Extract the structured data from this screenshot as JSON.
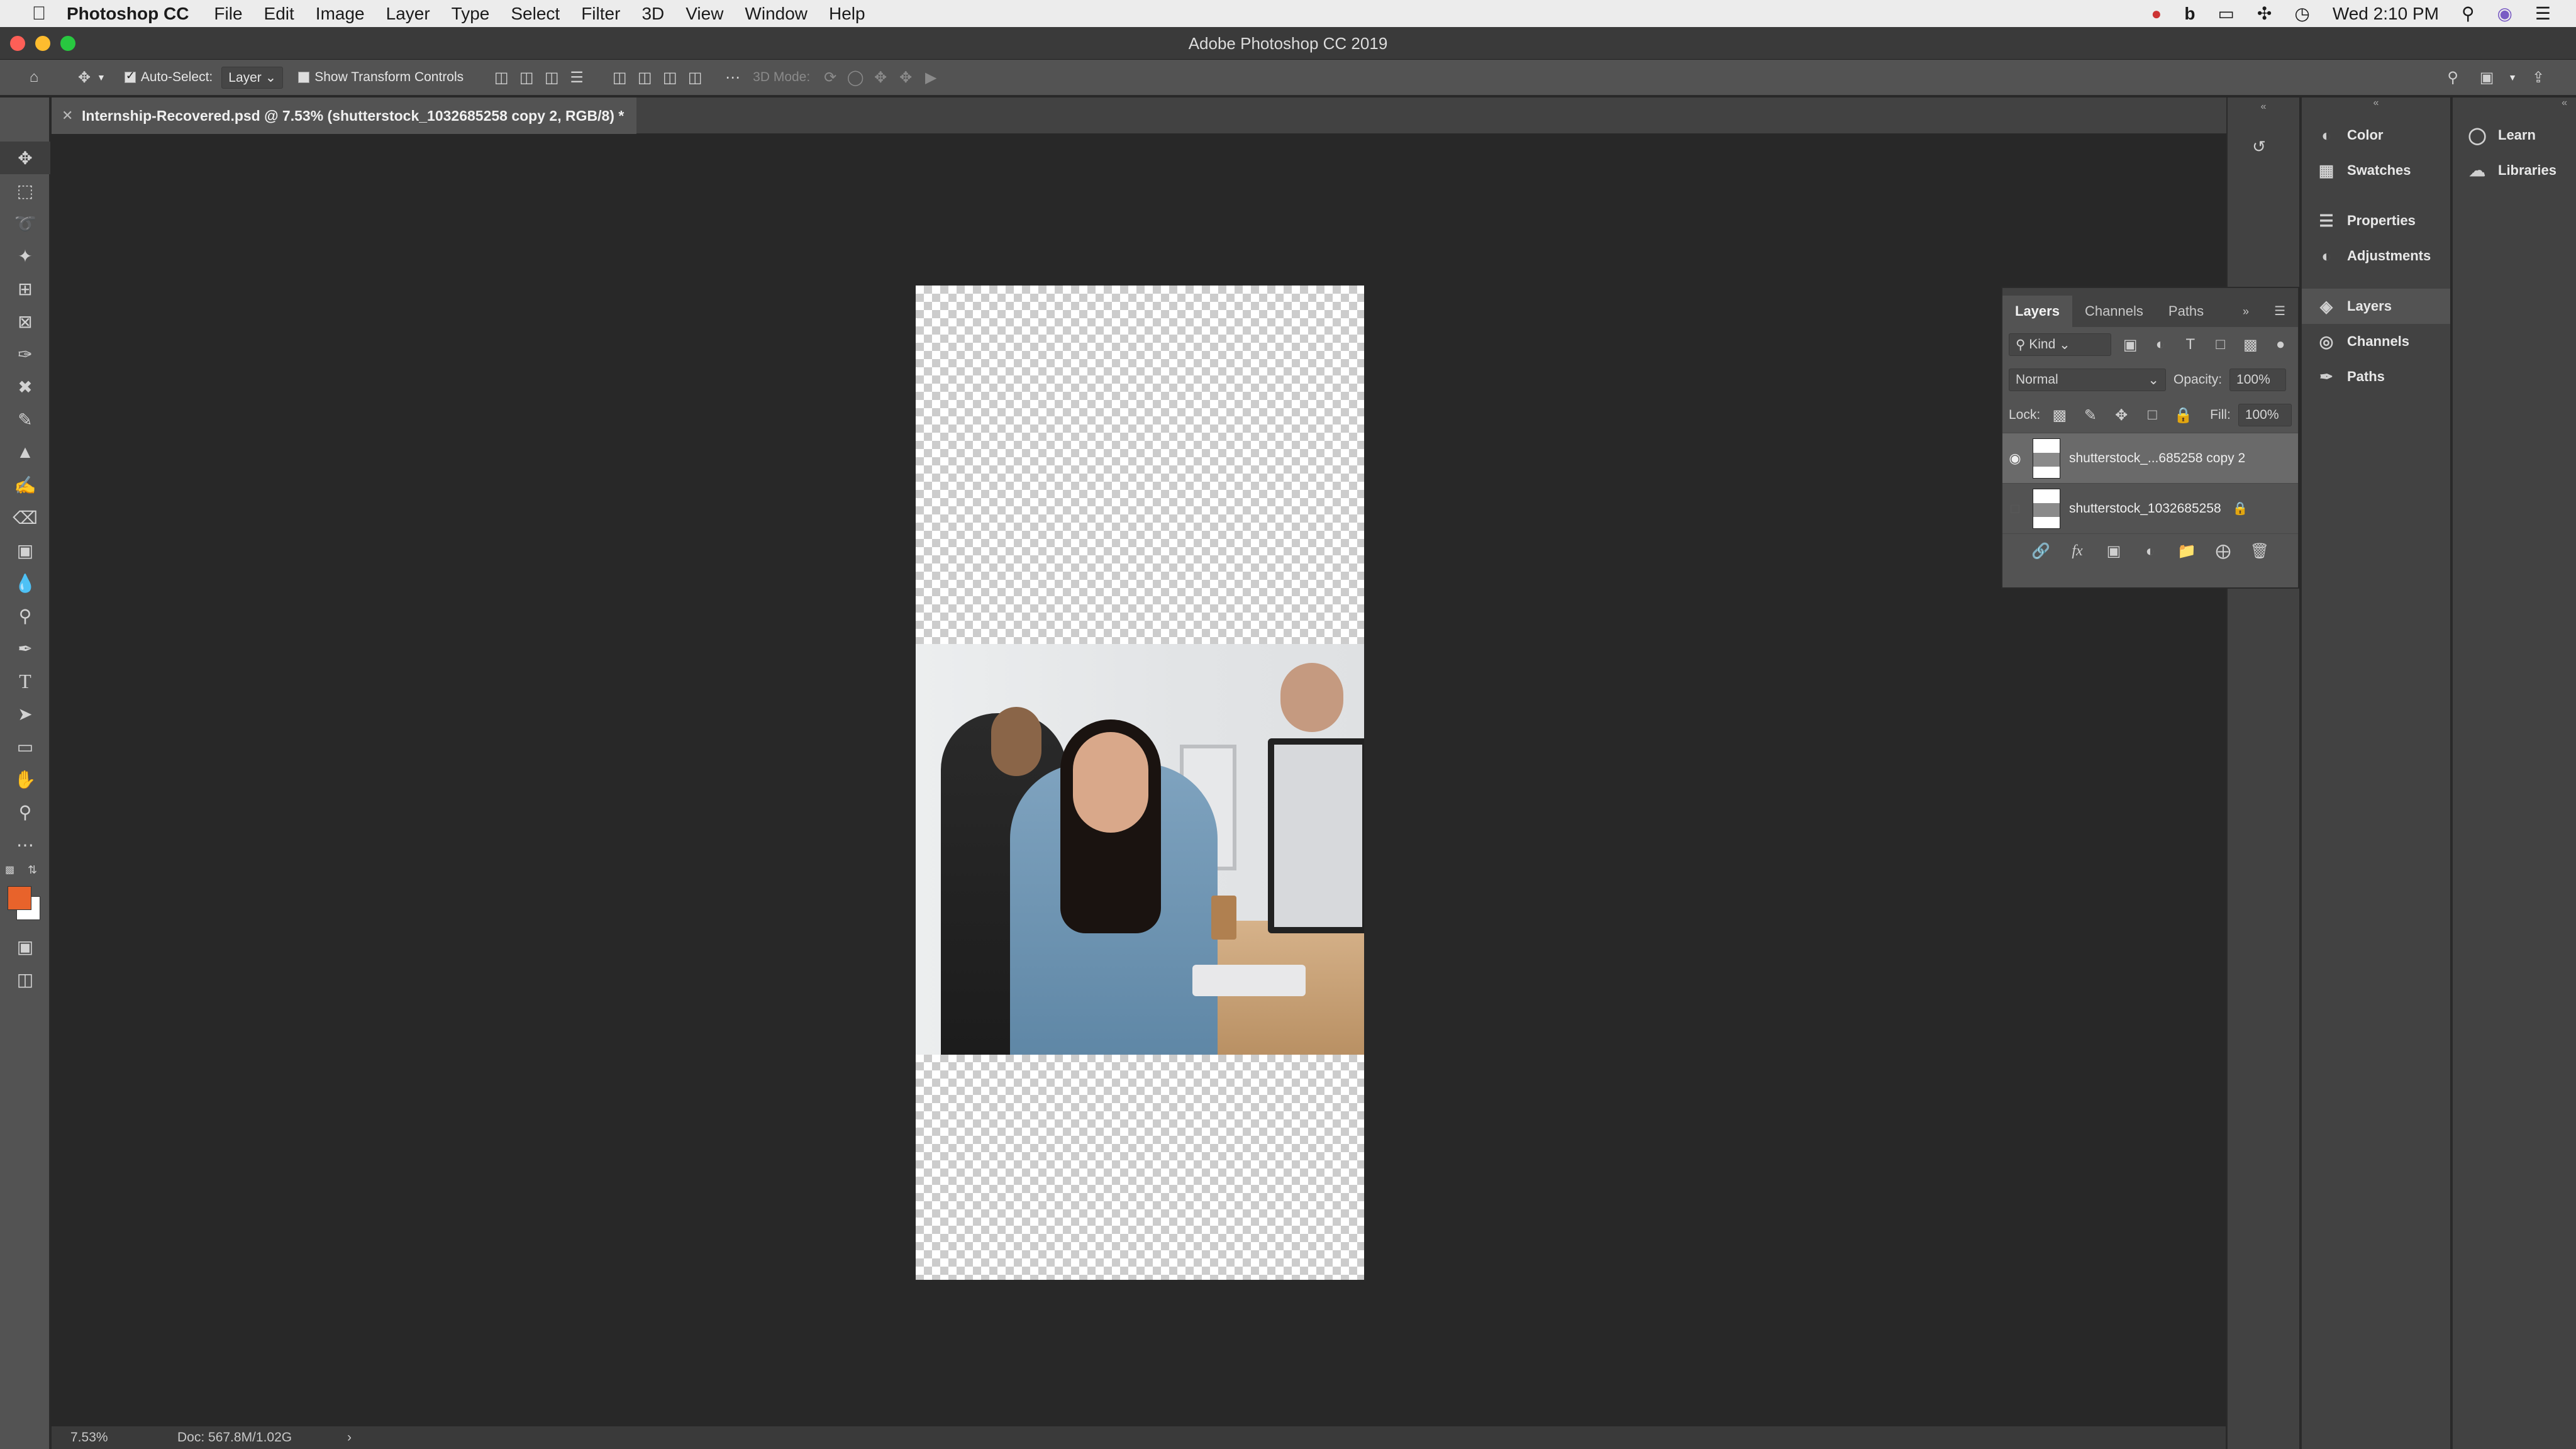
{
  "menubar": {
    "app_name": "Photoshop CC",
    "menus": [
      "File",
      "Edit",
      "Image",
      "Layer",
      "Type",
      "Select",
      "Filter",
      "3D",
      "View",
      "Window",
      "Help"
    ],
    "clock": "Wed 2:10 PM"
  },
  "window": {
    "title": "Adobe Photoshop CC 2019"
  },
  "options": {
    "auto_select_label": "Auto-Select:",
    "auto_select_target": "Layer",
    "transform_label": "Show Transform Controls",
    "mode_label": "3D Mode:"
  },
  "document": {
    "tab_title": "Internship-Recovered.psd @ 7.53% (shutterstock_1032685258 copy 2, RGB/8) *"
  },
  "status": {
    "zoom": "7.53%",
    "doc": "Doc: 567.8M/1.02G",
    "arrow": "›"
  },
  "colors": {
    "foreground": "#e8632b",
    "background": "#ffffff"
  },
  "panels_col": {
    "items": [
      "Color",
      "Swatches",
      "Properties",
      "Adjustments",
      "Layers",
      "Channels",
      "Paths"
    ]
  },
  "learn_col": {
    "items": [
      "Learn",
      "Libraries"
    ]
  },
  "layers_panel": {
    "tabs": [
      "Layers",
      "Channels",
      "Paths"
    ],
    "filter_kind": "Kind",
    "blend_mode": "Normal",
    "opacity_label": "Opacity:",
    "opacity_value": "100%",
    "lock_label": "Lock:",
    "fill_label": "Fill:",
    "fill_value": "100%",
    "layers": [
      {
        "name": "shutterstock_...685258 copy 2",
        "visible": true,
        "selected": true
      },
      {
        "name": "shutterstock_1032685258",
        "visible": false,
        "locked": true
      }
    ]
  }
}
